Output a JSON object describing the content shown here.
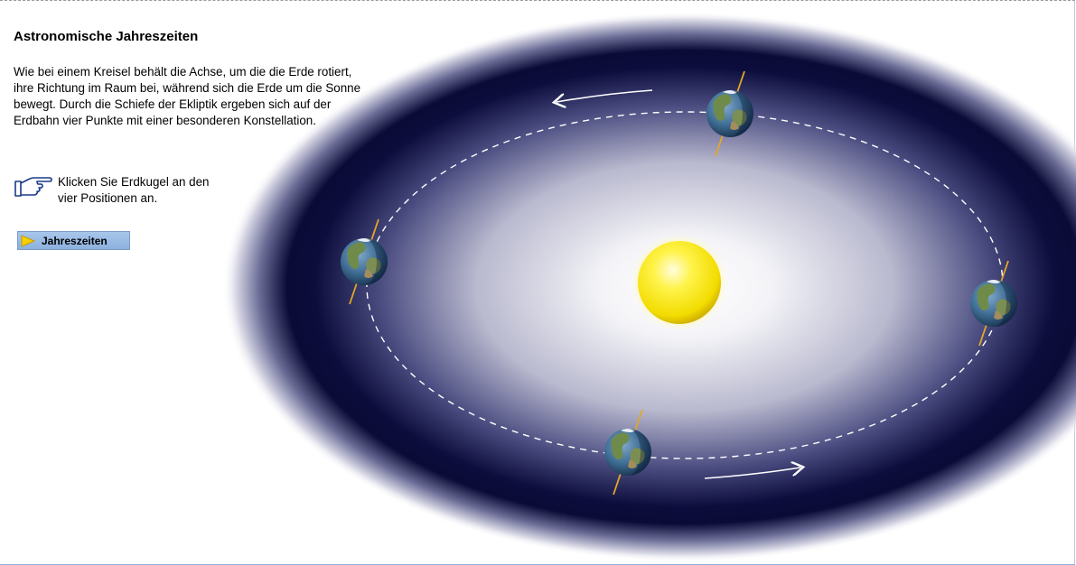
{
  "title": "Astronomische Jahreszeiten",
  "intro": "Wie bei einem Kreisel behält die Achse, um die die Erde rotiert, ihre Richtung im Raum bei, während sich die Erde um die Sonne bewegt. Durch die Schiefe der Ekliptik ergeben sich auf der Erdbahn vier Punkte mit einer besonderen Konstellation.",
  "hint": {
    "icon": "pointing-hand-icon",
    "line1": "Klicken Sie Erdkugel an den",
    "line2": "vier Positionen an."
  },
  "seasons_button": {
    "label": "Jahreszeiten",
    "icon": "play-triangle-icon"
  },
  "colors": {
    "space": "#0b0c3a",
    "glow": "#ffffff",
    "sun": "#f5e400",
    "axis": "#e2a726",
    "button": "#97b8e2"
  }
}
